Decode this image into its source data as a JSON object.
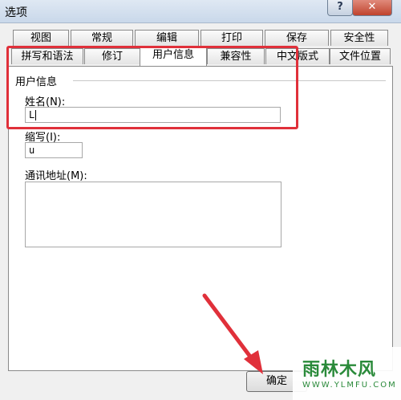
{
  "window": {
    "title": "选项",
    "help_label": "?",
    "close_label": "✕"
  },
  "tabs_row1": [
    "视图",
    "常规",
    "编辑",
    "打印",
    "保存",
    "安全性"
  ],
  "tabs_row2": [
    "拼写和语法",
    "修订",
    "用户信息",
    "兼容性",
    "中文版式",
    "文件位置"
  ],
  "active_tab": "用户信息",
  "user_info": {
    "group_label": "用户信息",
    "name_label": "姓名(N):",
    "name_value": "L",
    "initials_label": "缩写(I):",
    "initials_value": "u",
    "address_label": "通讯地址(M):",
    "address_value": ""
  },
  "buttons": {
    "ok_label": "确定"
  },
  "annotation_color": "#e0303a",
  "watermark": {
    "brand": "雨林木风",
    "url": "WWW.YLMFU.COM"
  }
}
